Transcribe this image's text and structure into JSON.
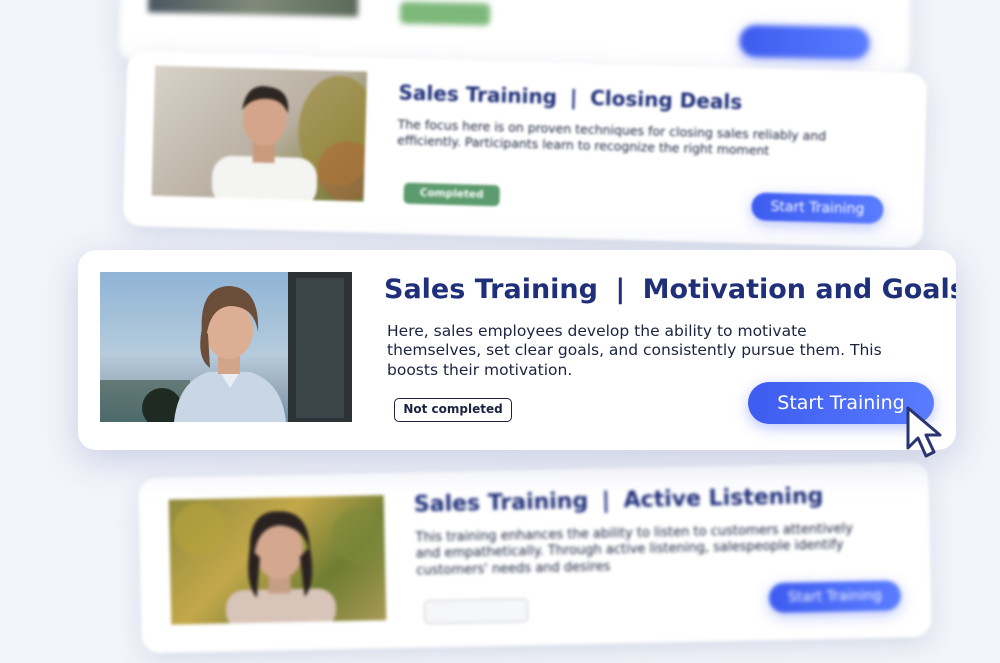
{
  "cards": [
    {
      "title_left": "",
      "title_right": "",
      "description": "",
      "status": "",
      "button": ""
    },
    {
      "title_left": "Sales Training",
      "title_right": "Closing Deals",
      "description": "The focus here is on proven techniques for closing sales reliably and efficiently. Participants learn to recognize the right moment",
      "status": "Completed",
      "button": "Start Training"
    },
    {
      "title_left": "Sales Training",
      "title_right": "Motivation and Goals",
      "description": "Here, sales employees develop the ability to motivate themselves, set clear goals, and consistently pursue them. This boosts their motivation.",
      "status": "Not completed",
      "button": "Start Training"
    },
    {
      "title_left": "Sales Training",
      "title_right": "Active Listening",
      "description": "This training enhances the ability to listen to customers attentively and empathetically. Through active listening, salespeople identify customers' needs and desires",
      "status": "",
      "button": "Start Training"
    }
  ],
  "title_separator": "|",
  "colors": {
    "title": "#1f2f7a",
    "button": "#4a6cf7",
    "completed_badge": "#5c9b6e",
    "not_completed_border": "#1c2340"
  },
  "icons": [
    "cursor-arrow-icon"
  ]
}
